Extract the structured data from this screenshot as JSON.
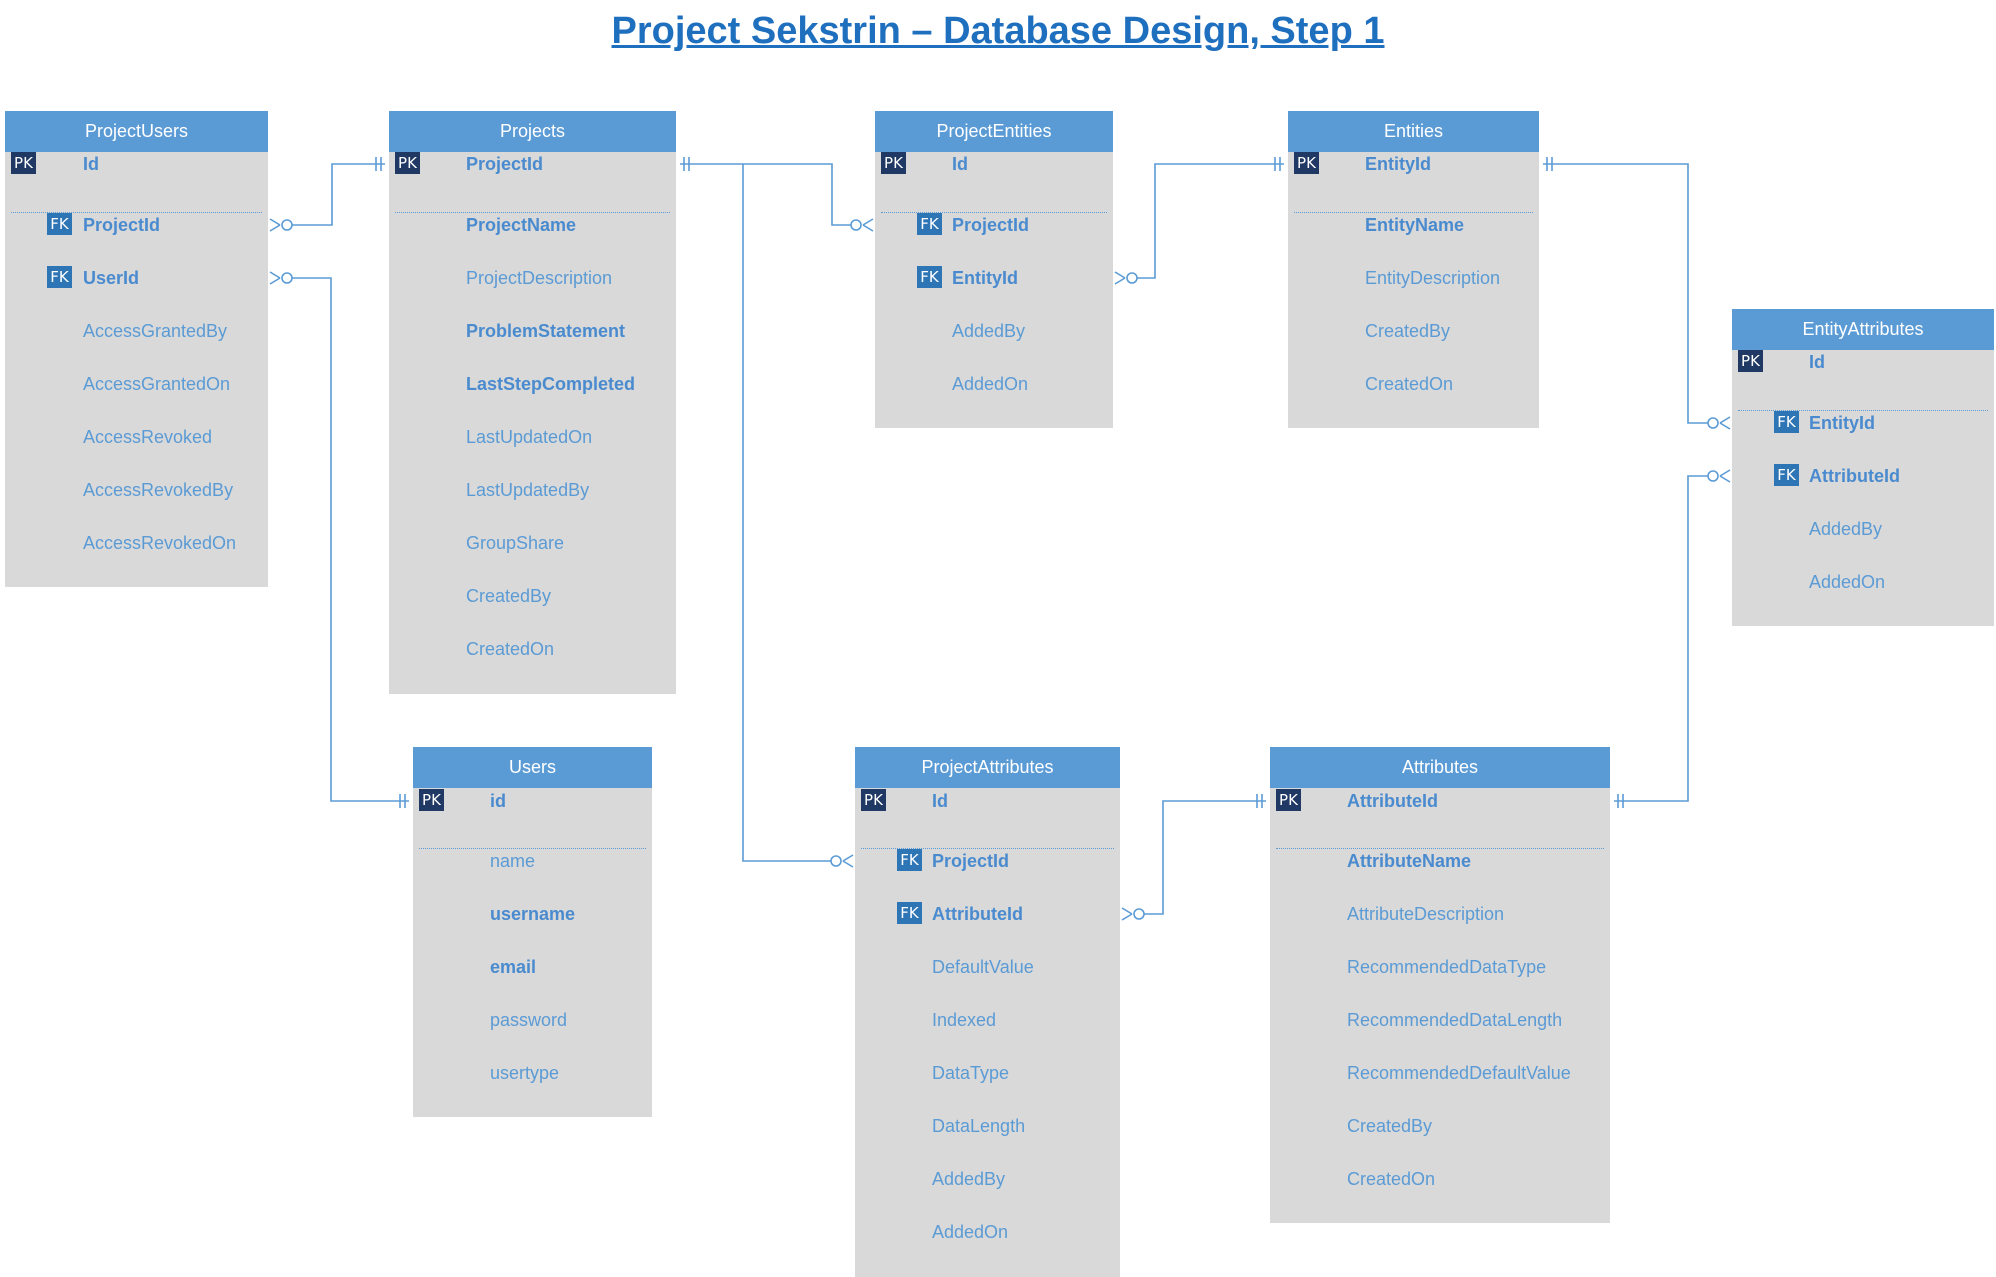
{
  "title": "Project Sekstrin – Database Design, Step 1",
  "colors": {
    "title": "#1f6fbf",
    "header": "#5b9bd5",
    "table_body": "#d9d9d9",
    "field_text": "#5b9bd5",
    "pk_badge": "#1f3864",
    "fk_badge": "#2e75b6",
    "connector": "#5b9bd5"
  },
  "tables": {
    "project_users": {
      "name": "ProjectUsers",
      "fields": [
        {
          "badge": "PK",
          "name": "Id",
          "bold": true
        },
        {
          "badge": "FK",
          "name": "ProjectId",
          "bold": true
        },
        {
          "badge": "FK",
          "name": "UserId",
          "bold": true
        },
        {
          "badge": "",
          "name": "AccessGrantedBy",
          "bold": false
        },
        {
          "badge": "",
          "name": "AccessGrantedOn",
          "bold": false
        },
        {
          "badge": "",
          "name": "AccessRevoked",
          "bold": false
        },
        {
          "badge": "",
          "name": "AccessRevokedBy",
          "bold": false
        },
        {
          "badge": "",
          "name": "AccessRevokedOn",
          "bold": false
        }
      ]
    },
    "projects": {
      "name": "Projects",
      "fields": [
        {
          "badge": "PK",
          "name": "ProjectId",
          "bold": true
        },
        {
          "badge": "",
          "name": "ProjectName",
          "bold": true
        },
        {
          "badge": "",
          "name": "ProjectDescription",
          "bold": false
        },
        {
          "badge": "",
          "name": "ProblemStatement",
          "bold": true
        },
        {
          "badge": "",
          "name": "LastStepCompleted",
          "bold": true
        },
        {
          "badge": "",
          "name": "LastUpdatedOn",
          "bold": false
        },
        {
          "badge": "",
          "name": "LastUpdatedBy",
          "bold": false
        },
        {
          "badge": "",
          "name": "GroupShare",
          "bold": false
        },
        {
          "badge": "",
          "name": "CreatedBy",
          "bold": false
        },
        {
          "badge": "",
          "name": "CreatedOn",
          "bold": false
        }
      ]
    },
    "project_entities": {
      "name": "ProjectEntities",
      "fields": [
        {
          "badge": "PK",
          "name": "Id",
          "bold": true
        },
        {
          "badge": "FK",
          "name": "ProjectId",
          "bold": true
        },
        {
          "badge": "FK",
          "name": "EntityId",
          "bold": true
        },
        {
          "badge": "",
          "name": "AddedBy",
          "bold": false
        },
        {
          "badge": "",
          "name": "AddedOn",
          "bold": false
        }
      ]
    },
    "entities": {
      "name": "Entities",
      "fields": [
        {
          "badge": "PK",
          "name": "EntityId",
          "bold": true
        },
        {
          "badge": "",
          "name": "EntityName",
          "bold": true
        },
        {
          "badge": "",
          "name": "EntityDescription",
          "bold": false
        },
        {
          "badge": "",
          "name": "CreatedBy",
          "bold": false
        },
        {
          "badge": "",
          "name": "CreatedOn",
          "bold": false
        }
      ]
    },
    "entity_attributes": {
      "name": "EntityAttributes",
      "fields": [
        {
          "badge": "PK",
          "name": "Id",
          "bold": true
        },
        {
          "badge": "FK",
          "name": "EntityId",
          "bold": true
        },
        {
          "badge": "FK",
          "name": "AttributeId",
          "bold": true
        },
        {
          "badge": "",
          "name": "AddedBy",
          "bold": false
        },
        {
          "badge": "",
          "name": "AddedOn",
          "bold": false
        }
      ]
    },
    "users": {
      "name": "Users",
      "fields": [
        {
          "badge": "PK",
          "name": "id",
          "bold": true
        },
        {
          "badge": "",
          "name": "name",
          "bold": false
        },
        {
          "badge": "",
          "name": "username",
          "bold": true
        },
        {
          "badge": "",
          "name": "email",
          "bold": true
        },
        {
          "badge": "",
          "name": "password",
          "bold": false
        },
        {
          "badge": "",
          "name": "usertype",
          "bold": false
        }
      ]
    },
    "project_attributes": {
      "name": "ProjectAttributes",
      "fields": [
        {
          "badge": "PK",
          "name": "Id",
          "bold": true
        },
        {
          "badge": "FK",
          "name": "ProjectId",
          "bold": true
        },
        {
          "badge": "FK",
          "name": "AttributeId",
          "bold": true
        },
        {
          "badge": "",
          "name": "DefaultValue",
          "bold": false
        },
        {
          "badge": "",
          "name": "Indexed",
          "bold": false
        },
        {
          "badge": "",
          "name": "DataType",
          "bold": false
        },
        {
          "badge": "",
          "name": "DataLength",
          "bold": false
        },
        {
          "badge": "",
          "name": "AddedBy",
          "bold": false
        },
        {
          "badge": "",
          "name": "AddedOn",
          "bold": false
        }
      ]
    },
    "attributes": {
      "name": "Attributes",
      "fields": [
        {
          "badge": "PK",
          "name": "AttributeId",
          "bold": true
        },
        {
          "badge": "",
          "name": "AttributeName",
          "bold": true
        },
        {
          "badge": "",
          "name": "AttributeDescription",
          "bold": false
        },
        {
          "badge": "",
          "name": "RecommendedDataType",
          "bold": false
        },
        {
          "badge": "",
          "name": "RecommendedDataLength",
          "bold": false
        },
        {
          "badge": "",
          "name": "RecommendedDefaultValue",
          "bold": false
        },
        {
          "badge": "",
          "name": "CreatedBy",
          "bold": false
        },
        {
          "badge": "",
          "name": "CreatedOn",
          "bold": false
        }
      ]
    }
  },
  "relationships": [
    {
      "from": "Projects.ProjectId",
      "to": "ProjectUsers.ProjectId",
      "from_cardinality": "one",
      "to_cardinality": "zero-or-many"
    },
    {
      "from": "Users.id",
      "to": "ProjectUsers.UserId",
      "from_cardinality": "one",
      "to_cardinality": "zero-or-many"
    },
    {
      "from": "Projects.ProjectId",
      "to": "ProjectEntities.ProjectId",
      "from_cardinality": "one",
      "to_cardinality": "zero-or-many"
    },
    {
      "from": "Projects.ProjectId",
      "to": "ProjectAttributes.ProjectId",
      "from_cardinality": "one",
      "to_cardinality": "zero-or-many"
    },
    {
      "from": "Entities.EntityId",
      "to": "ProjectEntities.EntityId",
      "from_cardinality": "one",
      "to_cardinality": "zero-or-many"
    },
    {
      "from": "Entities.EntityId",
      "to": "EntityAttributes.EntityId",
      "from_cardinality": "one",
      "to_cardinality": "zero-or-many"
    },
    {
      "from": "Attributes.AttributeId",
      "to": "ProjectAttributes.AttributeId",
      "from_cardinality": "one",
      "to_cardinality": "zero-or-many"
    },
    {
      "from": "Attributes.AttributeId",
      "to": "EntityAttributes.AttributeId",
      "from_cardinality": "one",
      "to_cardinality": "zero-or-many"
    }
  ]
}
